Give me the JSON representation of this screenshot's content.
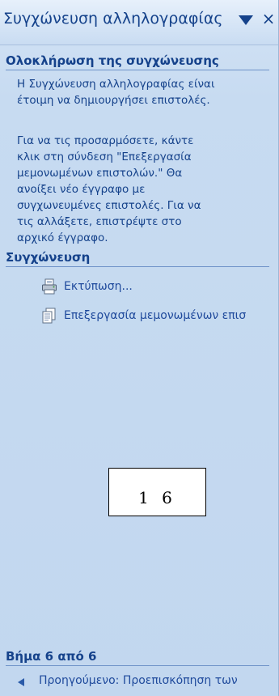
{
  "task_pane": {
    "title": "Συγχώνευση αλληλογραφίας",
    "icons": {
      "menu": "chevron-down-icon",
      "close": "close-icon"
    }
  },
  "completion_section": {
    "heading": "Ολοκλήρωση της συγχώνευσης",
    "paragraph_1": [
      "Η Συγχώνευση αλληλογραφίας είναι",
      "έτοιμη να δημιουργήσει επιστολές."
    ],
    "paragraph_2": [
      "Για να τις προσαρμόσετε, κάντε",
      "κλικ στη σύνδεση \"Επεξεργασία",
      "μεμονωμένων επιστολών.\" Θα",
      "ανοίξει νέο έγγραφο με",
      "συγχωνευμένες επιστολές. Για να",
      "τις αλλάξετε, επιστρέψτε στο",
      "αρχικό έγγραφο."
    ]
  },
  "merge_section": {
    "heading": "Συγχώνευση",
    "print_link": {
      "label": "Εκτύπωση...",
      "icon": "printer-icon"
    },
    "edit_link": {
      "label": "Επεξεργασία μεμονωμένων επισ",
      "icon": "documents-icon"
    }
  },
  "page_number_box": {
    "text": "1 6"
  },
  "wizard_footer": {
    "step": "Βήμα 6 από 6",
    "previous_link": {
      "label": "Προηγούμενο: Προεπισκόπηση των",
      "icon": "back-arrow-icon"
    }
  },
  "colors": {
    "heading_text": "#15428b",
    "link_text": "#1f4a9c",
    "pane_background": "#c7dbf1",
    "section_rule": "#6f93c8"
  }
}
